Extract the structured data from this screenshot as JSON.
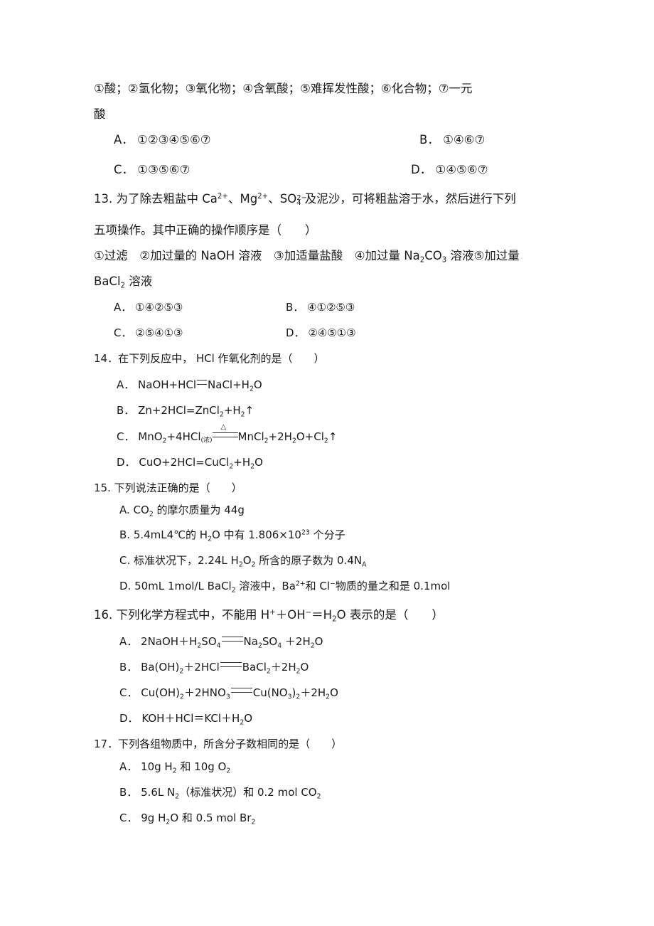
{
  "q12": {
    "items_line1": "①酸；②氢化物；③氧化物；④含氧酸；⑤难挥发性酸；⑥化合物；⑦一元",
    "items_line2": "酸",
    "options": [
      {
        "label": "A．",
        "text": "①②③④⑤⑥⑦"
      },
      {
        "label": "B．",
        "text": "①④⑥⑦"
      },
      {
        "label": "C．",
        "text": "①③⑤⑥⑦"
      },
      {
        "label": "D．",
        "text": "①④⑤⑥⑦"
      }
    ]
  },
  "q13": {
    "stem_line1": [
      {
        "t": "13. 为了除去粗盐中 Ca"
      },
      {
        "sup": "2+"
      },
      {
        "t": "、Mg"
      },
      {
        "sup": "2+"
      },
      {
        "t": "、SO"
      },
      {
        "stack": [
          "2−",
          "4"
        ]
      },
      {
        "t": " 及泥沙，可将粗盐溶于水，然后进行下列"
      }
    ],
    "stem_line2": "五项操作。其中正确的操作顺序是（　　）",
    "ops_line1": [
      {
        "t": "①过滤　②加过量的 NaOH 溶液　③加适量盐酸　④加过量 Na"
      },
      {
        "sub": "2"
      },
      {
        "t": "CO"
      },
      {
        "sub": "3"
      },
      {
        "t": " 溶液⑤加过量"
      }
    ],
    "ops_line2": [
      {
        "t": "BaCl"
      },
      {
        "sub": "2"
      },
      {
        "t": " 溶液"
      }
    ],
    "options": [
      {
        "label": "A．",
        "text": "①④②⑤③"
      },
      {
        "label": "B．",
        "text": "④①②⑤③"
      },
      {
        "label": "C．",
        "text": "②⑤④①③"
      },
      {
        "label": "D．",
        "text": "②④⑤①③"
      }
    ]
  },
  "q14": {
    "stem": "14．在下列反应中，  HCl  作氧化剂的是（　　）",
    "options": [
      {
        "label": "A．",
        "rich": [
          {
            "t": "NaOH+HCl"
          },
          {
            "eq": "single"
          },
          {
            "t": "NaCl+H"
          },
          {
            "sub": "2"
          },
          {
            "t": "O"
          }
        ]
      },
      {
        "label": "B．",
        "rich": [
          {
            "t": "Zn+2HCl=ZnCl"
          },
          {
            "sub": "2"
          },
          {
            "t": "+H"
          },
          {
            "sub": "2"
          },
          {
            "t": "↑"
          }
        ]
      },
      {
        "label": "C．",
        "rich": [
          {
            "t": "MnO"
          },
          {
            "sub": "2"
          },
          {
            "t": "+4HCl"
          },
          {
            "small": "(浓)"
          },
          {
            "heat": "△"
          },
          {
            "t": "MnCl"
          },
          {
            "sub": "2"
          },
          {
            "t": "+2H"
          },
          {
            "sub": "2"
          },
          {
            "t": "O+Cl"
          },
          {
            "sub": "2"
          },
          {
            "t": "↑"
          }
        ]
      },
      {
        "label": "D．",
        "rich": [
          {
            "t": "CuO+2HCl=CuCl"
          },
          {
            "sub": "2"
          },
          {
            "t": "+H"
          },
          {
            "sub": "2"
          },
          {
            "t": "O"
          }
        ]
      }
    ]
  },
  "q15": {
    "stem": "15. 下列说法正确的是（　　）",
    "options": [
      {
        "rich": [
          {
            "t": "A. CO"
          },
          {
            "sub": "2"
          },
          {
            "t": " 的摩尔质量为 44g"
          }
        ]
      },
      {
        "rich": [
          {
            "t": "B. 5.4mL4℃的 H"
          },
          {
            "sub": "2"
          },
          {
            "t": "O 中有 1.806×10"
          },
          {
            "sup": "23"
          },
          {
            "t": " 个分子"
          }
        ]
      },
      {
        "rich": [
          {
            "t": "C.  标准状况下，2.24L H"
          },
          {
            "sub": "2"
          },
          {
            "t": "O"
          },
          {
            "sub": "2"
          },
          {
            "t": " 所含的原子数为 0.4N"
          },
          {
            "sub": "A"
          }
        ]
      },
      {
        "rich": [
          {
            "t": "D. 50mL 1mol/L BaCl"
          },
          {
            "sub": "2"
          },
          {
            "t": " 溶液中，Ba"
          },
          {
            "sup": "2+"
          },
          {
            "t": "和 Cl"
          },
          {
            "sup": "−"
          },
          {
            "t": "物质的量之和是 0.1mol"
          }
        ]
      }
    ]
  },
  "q16": {
    "stem": [
      {
        "t": "16. 下列化学方程式中，不能用 H"
      },
      {
        "sup": "+"
      },
      {
        "t": "＋OH"
      },
      {
        "sup": "−"
      },
      {
        "t": "＝H"
      },
      {
        "sub": "2"
      },
      {
        "t": "O 表示的是（　　）"
      }
    ],
    "options": [
      {
        "label": "A．",
        "rich": [
          {
            "t": "2NaOH＋H"
          },
          {
            "sub": "2"
          },
          {
            "t": "SO"
          },
          {
            "sub": "4"
          },
          {
            "eq": "long"
          },
          {
            "t": "Na"
          },
          {
            "sub": "2"
          },
          {
            "t": "SO"
          },
          {
            "sub": "4"
          },
          {
            "t": " ＋2H"
          },
          {
            "sub": "2"
          },
          {
            "t": "O"
          }
        ]
      },
      {
        "label": "B．",
        "rich": [
          {
            "t": "Ba(OH)"
          },
          {
            "sub": "2"
          },
          {
            "t": "＋2HCl"
          },
          {
            "eq": "long"
          },
          {
            "t": "BaCl"
          },
          {
            "sub": "2"
          },
          {
            "t": "＋2H"
          },
          {
            "sub": "2"
          },
          {
            "t": "O"
          }
        ]
      },
      {
        "label": "C．",
        "rich": [
          {
            "t": "Cu(OH)"
          },
          {
            "sub": "2"
          },
          {
            "t": "＋2HNO"
          },
          {
            "sub": "3"
          },
          {
            "eq": "long"
          },
          {
            "t": "Cu(NO"
          },
          {
            "sub": "3"
          },
          {
            "t": ")"
          },
          {
            "sub": "2"
          },
          {
            "t": "＋2H"
          },
          {
            "sub": "2"
          },
          {
            "t": "O"
          }
        ]
      },
      {
        "label": "D．",
        "rich": [
          {
            "t": "KOH＋HCl＝KCl＋H"
          },
          {
            "sub": "2"
          },
          {
            "t": "O"
          }
        ]
      }
    ]
  },
  "q17": {
    "stem": "17．下列各组物质中，所含分子数相同的是（　　）",
    "options": [
      {
        "label": "A．",
        "rich": [
          {
            "t": "10g H"
          },
          {
            "sub": "2"
          },
          {
            "t": " 和 10g O"
          },
          {
            "sub": "2"
          }
        ]
      },
      {
        "label": "B．",
        "rich": [
          {
            "t": "5.6L N"
          },
          {
            "sub": "2"
          },
          {
            "t": "（标准状况）和 0.2 mol CO"
          },
          {
            "sub": "2"
          }
        ]
      },
      {
        "label": "C．",
        "rich": [
          {
            "t": "9g H"
          },
          {
            "sub": "2"
          },
          {
            "t": "O 和 0.5 mol Br"
          },
          {
            "sub": "2"
          }
        ]
      }
    ]
  }
}
